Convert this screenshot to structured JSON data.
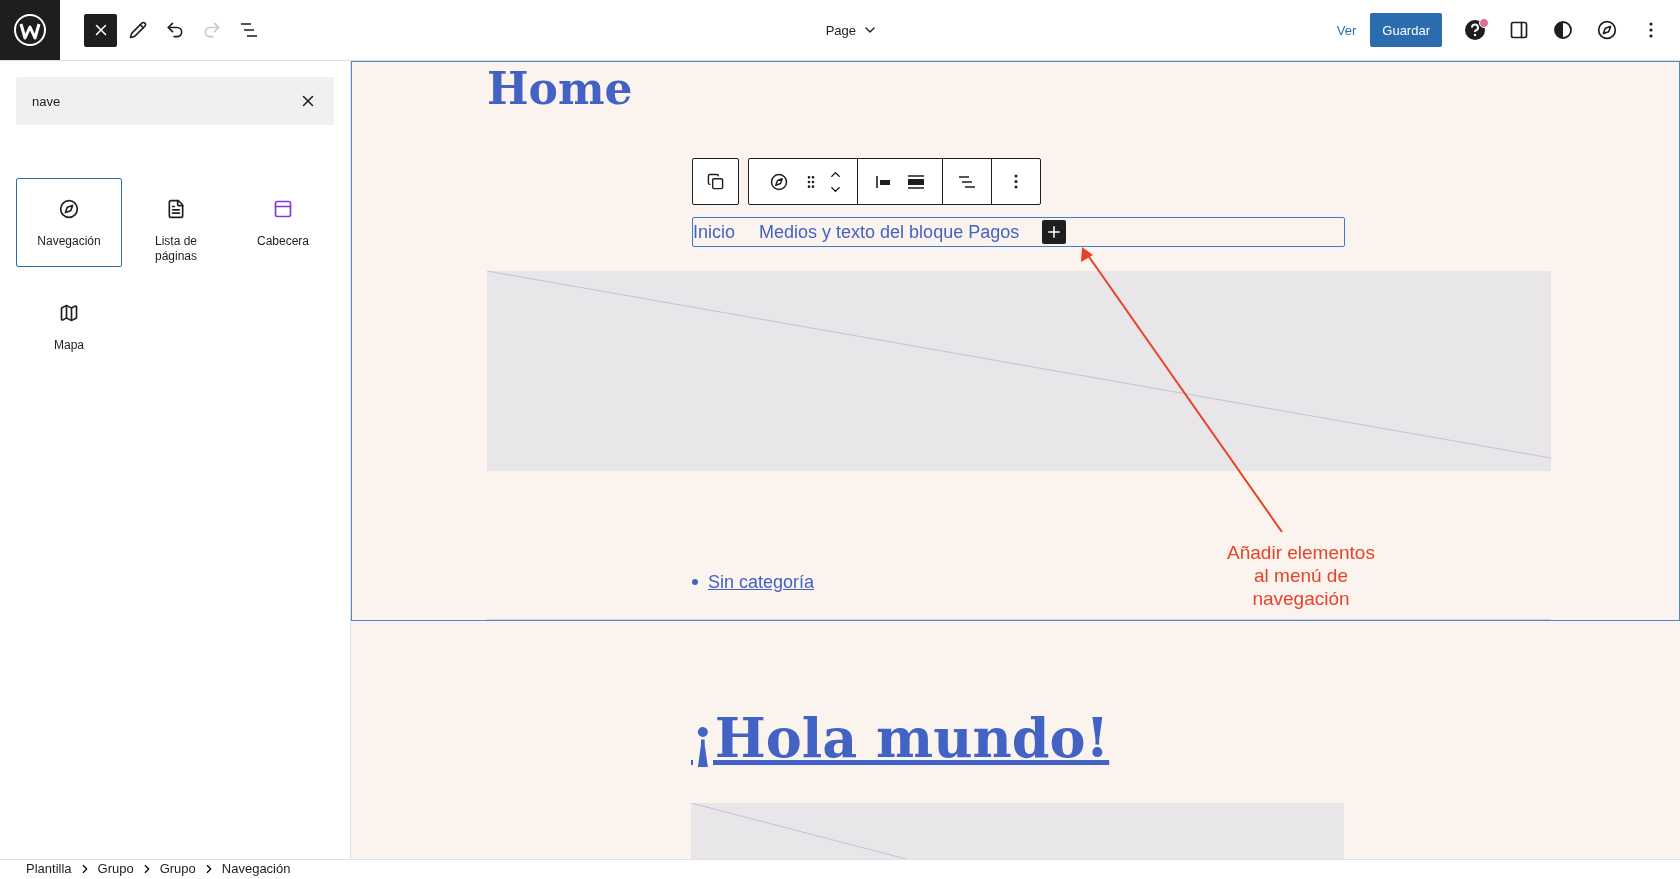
{
  "toolbar": {
    "inserter_open": true,
    "undo_disabled": false,
    "redo_disabled": true,
    "document": "Page",
    "view": "Ver",
    "save": "Guardar",
    "help_badge": true
  },
  "sidebar": {
    "search": {
      "value": "nave"
    },
    "blocks": [
      {
        "kind": "navigation",
        "label": "Navegación",
        "selected": true
      },
      {
        "kind": "page-list",
        "label": "Lista de páginas",
        "selected": false
      },
      {
        "kind": "header",
        "label": "Cabecera",
        "selected": false
      },
      {
        "kind": "map",
        "label": "Mapa",
        "selected": false
      }
    ]
  },
  "canvas": {
    "title": "Home",
    "nav_items": [
      "Inicio",
      "Medios y texto del bloque Pagos"
    ],
    "categories": [
      "Sin categoría"
    ],
    "post_title": "¡Hola mundo!",
    "annotation": "Añadir elementos al menú de navegación"
  },
  "breadcrumb": [
    "Plantilla",
    "Grupo",
    "Grupo",
    "Navegación"
  ]
}
